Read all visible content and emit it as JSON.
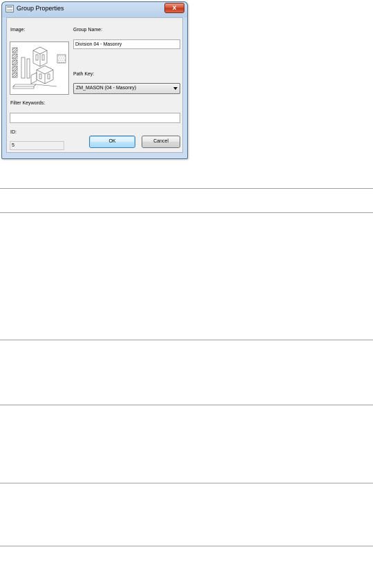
{
  "window": {
    "title": "Group Properties",
    "close_glyph": "x"
  },
  "form": {
    "image_label": "Image:",
    "group_name_label": "Group Name:",
    "group_name_value": "Division 04 - Masonry",
    "path_key_label": "Path Key:",
    "path_key_value": "ZM_MASON   (04 - Masonry)",
    "filter_keywords_label": "Filter Keywords:",
    "filter_keywords_value": "",
    "id_label": "ID:",
    "id_value": "5"
  },
  "buttons": {
    "ok": "OK",
    "cancel": "Cancel"
  },
  "icons": [
    "window-app-icon",
    "close-icon",
    "dropdown-arrow-icon",
    "masonry-preview-image"
  ],
  "colors": {
    "title_gradient_top": "#cfe0f2",
    "close_red": "#c4391c",
    "default_button_border": "#3c7fb1"
  }
}
